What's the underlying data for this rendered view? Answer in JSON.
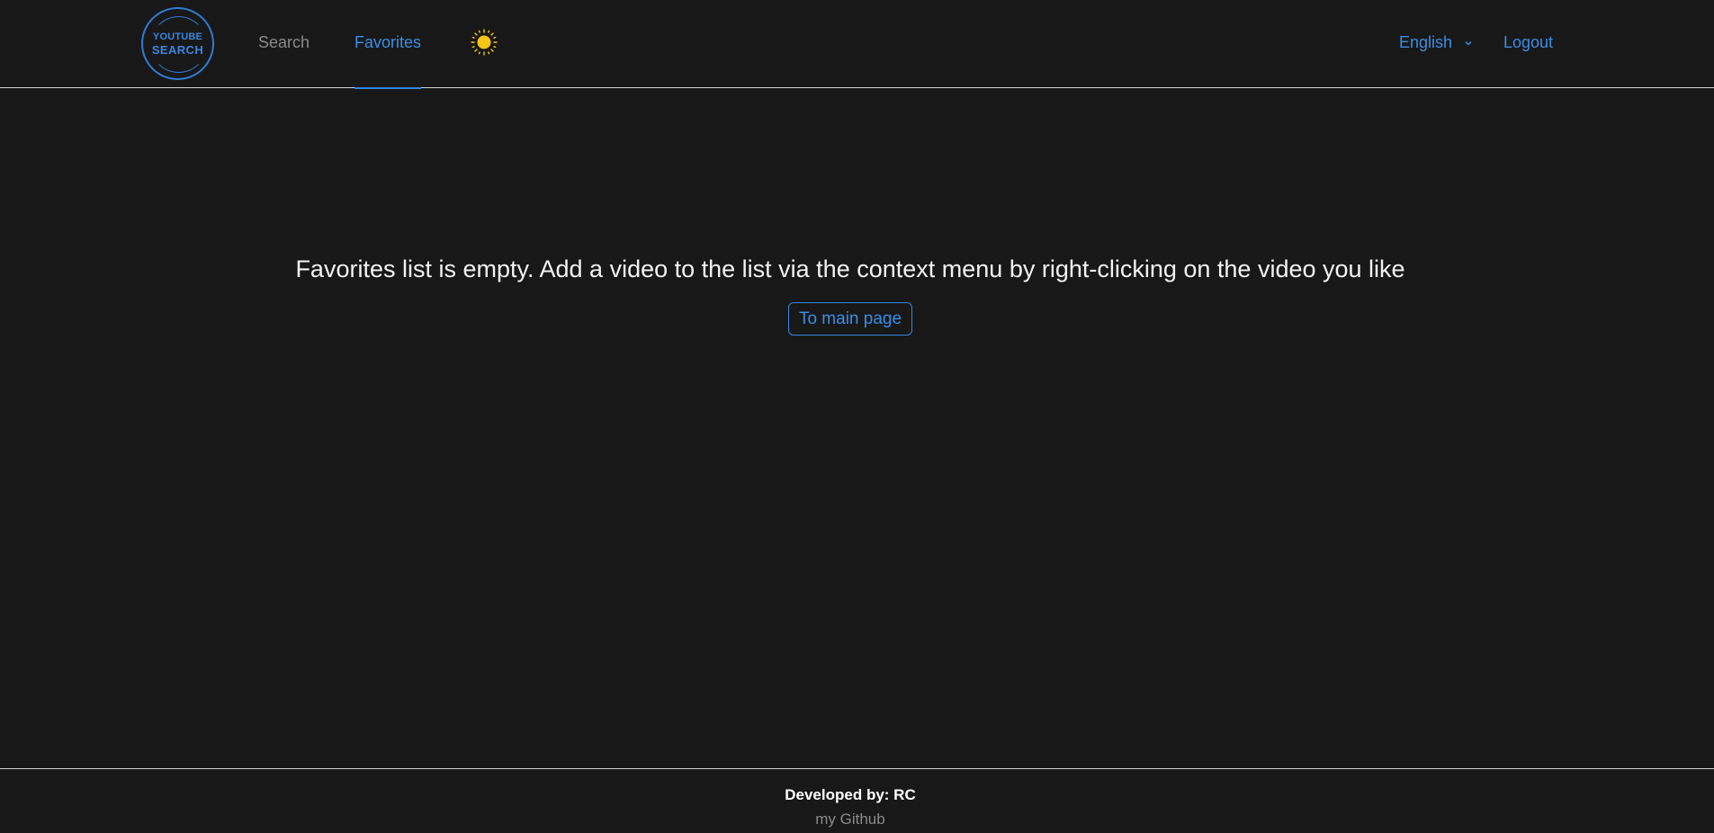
{
  "header": {
    "logo": {
      "line1": "YOUTUBE",
      "line2": "SEARCH"
    },
    "nav": {
      "search_label": "Search",
      "favorites_label": "Favorites",
      "active": "Favorites"
    },
    "theme_icon": "sun-icon",
    "language": {
      "selected": "English",
      "icon": "chevron-down-icon"
    },
    "logout_label": "Logout"
  },
  "main": {
    "empty_message": "Favorites list is empty. Add a video to the list via the context menu by right-clicking on the video you like",
    "to_main_label": "To main page"
  },
  "footer": {
    "developer": "Developed by: RC",
    "github_link": "my Github"
  },
  "colors": {
    "background": "#181818",
    "accent": "#3a8ee6",
    "muted": "#8a8a8a",
    "sun": "#f5c518"
  }
}
